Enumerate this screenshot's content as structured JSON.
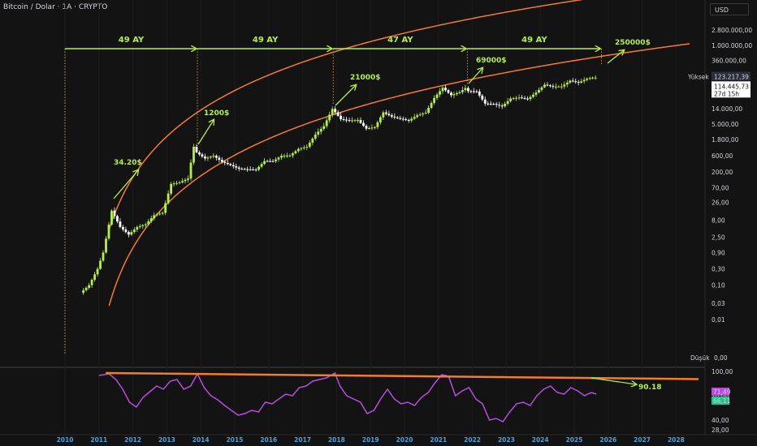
{
  "header": {
    "title": "Bitcoin / Dolar · 1A · CRYPTO",
    "currency": "USD"
  },
  "colors": {
    "up": "#b5f23a",
    "down": "#ffffff",
    "band": "#f57c2a",
    "annotation": "#b5f23a",
    "rsi": "#b84ce0",
    "background": "#131313"
  },
  "chart_data": {
    "type": "candlestick",
    "price_axis": {
      "scale": "log",
      "ticks": [
        "2.800.000,00",
        "1.000.000,00",
        "360.000,00",
        "40.000,00",
        "14.000,00",
        "5.000,00",
        "1.800,00",
        "600,00",
        "200,00",
        "70,00",
        "26,00",
        "8,00",
        "2,50",
        "0,90",
        "0,30",
        "0,10",
        "0,03",
        "0,01"
      ],
      "high_label": "Yüksek",
      "high_value": "123.217,39",
      "last_value": "114.445,73",
      "countdown": "27d 15h",
      "low_label": "Düşük",
      "low_value": "0,00"
    },
    "x_axis": {
      "ticks": [
        "2010",
        "2011",
        "2012",
        "2013",
        "2014",
        "2015",
        "2016",
        "2017",
        "2018",
        "2019",
        "2020",
        "2021",
        "2022",
        "2023",
        "2024",
        "2025",
        "2026",
        "2027",
        "2028"
      ]
    },
    "price_path": [
      [
        "2010-07",
        0.06
      ],
      [
        "2010-10",
        0.1
      ],
      [
        "2011-01",
        0.3
      ],
      [
        "2011-03",
        0.9
      ],
      [
        "2011-06",
        15
      ],
      [
        "2011-09",
        5
      ],
      [
        "2011-12",
        3
      ],
      [
        "2012-03",
        5
      ],
      [
        "2012-06",
        6
      ],
      [
        "2012-09",
        11
      ],
      [
        "2012-12",
        13
      ],
      [
        "2013-03",
        90
      ],
      [
        "2013-06",
        100
      ],
      [
        "2013-09",
        130
      ],
      [
        "2013-11",
        1100
      ],
      [
        "2013-12",
        750
      ],
      [
        "2014-03",
        500
      ],
      [
        "2014-06",
        600
      ],
      [
        "2014-09",
        400
      ],
      [
        "2014-12",
        320
      ],
      [
        "2015-03",
        250
      ],
      [
        "2015-06",
        240
      ],
      [
        "2015-09",
        235
      ],
      [
        "2015-12",
        420
      ],
      [
        "2016-03",
        415
      ],
      [
        "2016-06",
        600
      ],
      [
        "2016-09",
        610
      ],
      [
        "2016-12",
        950
      ],
      [
        "2017-03",
        1100
      ],
      [
        "2017-06",
        2500
      ],
      [
        "2017-09",
        4400
      ],
      [
        "2017-12",
        14000
      ],
      [
        "2018-03",
        7000
      ],
      [
        "2018-06",
        6400
      ],
      [
        "2018-09",
        6600
      ],
      [
        "2018-12",
        3700
      ],
      [
        "2019-03",
        4100
      ],
      [
        "2019-06",
        11000
      ],
      [
        "2019-09",
        8300
      ],
      [
        "2019-12",
        7200
      ],
      [
        "2020-03",
        6400
      ],
      [
        "2020-06",
        9100
      ],
      [
        "2020-09",
        10800
      ],
      [
        "2020-12",
        29000
      ],
      [
        "2021-03",
        58000
      ],
      [
        "2021-06",
        35000
      ],
      [
        "2021-09",
        43000
      ],
      [
        "2021-11",
        57000
      ],
      [
        "2021-12",
        46000
      ],
      [
        "2022-03",
        45000
      ],
      [
        "2022-06",
        20000
      ],
      [
        "2022-09",
        19400
      ],
      [
        "2022-12",
        16500
      ],
      [
        "2023-03",
        28000
      ],
      [
        "2023-06",
        30000
      ],
      [
        "2023-09",
        27000
      ],
      [
        "2023-12",
        42000
      ],
      [
        "2024-03",
        71000
      ],
      [
        "2024-06",
        62000
      ],
      [
        "2024-09",
        63000
      ],
      [
        "2024-12",
        93000
      ],
      [
        "2025-03",
        82000
      ],
      [
        "2025-06",
        107000
      ],
      [
        "2025-08",
        114445
      ]
    ],
    "cycles": [
      {
        "label": "49 AY"
      },
      {
        "label": "49 AY"
      },
      {
        "label": "47 AY"
      },
      {
        "label": "49 AY"
      }
    ],
    "peak_labels": [
      "34.20$",
      "1200$",
      "21000$",
      "69000$",
      "250000$"
    ],
    "rsi": {
      "ticks": [
        "100,00",
        "70,00",
        "40,00",
        "28,00"
      ],
      "value_1": "71,49",
      "value_2": "66,11",
      "annotation": "90.18",
      "path": [
        [
          2011.0,
          95
        ],
        [
          2011.3,
          97
        ],
        [
          2011.5,
          90
        ],
        [
          2011.7,
          78
        ],
        [
          2011.9,
          62
        ],
        [
          2012.1,
          56
        ],
        [
          2012.3,
          68
        ],
        [
          2012.5,
          75
        ],
        [
          2012.7,
          82
        ],
        [
          2012.9,
          78
        ],
        [
          2013.1,
          88
        ],
        [
          2013.3,
          90
        ],
        [
          2013.5,
          78
        ],
        [
          2013.7,
          82
        ],
        [
          2013.9,
          97
        ],
        [
          2014.1,
          80
        ],
        [
          2014.3,
          70
        ],
        [
          2014.5,
          65
        ],
        [
          2014.7,
          58
        ],
        [
          2014.9,
          52
        ],
        [
          2015.1,
          46
        ],
        [
          2015.3,
          48
        ],
        [
          2015.5,
          52
        ],
        [
          2015.7,
          50
        ],
        [
          2015.9,
          62
        ],
        [
          2016.1,
          60
        ],
        [
          2016.3,
          66
        ],
        [
          2016.5,
          72
        ],
        [
          2016.7,
          70
        ],
        [
          2016.9,
          80
        ],
        [
          2017.1,
          82
        ],
        [
          2017.3,
          88
        ],
        [
          2017.5,
          90
        ],
        [
          2017.7,
          92
        ],
        [
          2017.95,
          98
        ],
        [
          2018.1,
          82
        ],
        [
          2018.3,
          70
        ],
        [
          2018.5,
          66
        ],
        [
          2018.7,
          62
        ],
        [
          2018.9,
          48
        ],
        [
          2019.1,
          52
        ],
        [
          2019.3,
          66
        ],
        [
          2019.5,
          78
        ],
        [
          2019.7,
          66
        ],
        [
          2019.9,
          60
        ],
        [
          2020.1,
          62
        ],
        [
          2020.3,
          58
        ],
        [
          2020.5,
          68
        ],
        [
          2020.7,
          74
        ],
        [
          2020.9,
          86
        ],
        [
          2021.1,
          96
        ],
        [
          2021.3,
          94
        ],
        [
          2021.5,
          70
        ],
        [
          2021.7,
          76
        ],
        [
          2021.9,
          80
        ],
        [
          2022.1,
          66
        ],
        [
          2022.3,
          60
        ],
        [
          2022.5,
          40
        ],
        [
          2022.7,
          42
        ],
        [
          2022.9,
          38
        ],
        [
          2023.1,
          50
        ],
        [
          2023.3,
          60
        ],
        [
          2023.5,
          62
        ],
        [
          2023.7,
          58
        ],
        [
          2023.9,
          70
        ],
        [
          2024.1,
          78
        ],
        [
          2024.3,
          82
        ],
        [
          2024.5,
          74
        ],
        [
          2024.7,
          72
        ],
        [
          2024.9,
          80
        ],
        [
          2025.1,
          76
        ],
        [
          2025.3,
          70
        ],
        [
          2025.5,
          74
        ],
        [
          2025.65,
          72
        ]
      ]
    }
  }
}
